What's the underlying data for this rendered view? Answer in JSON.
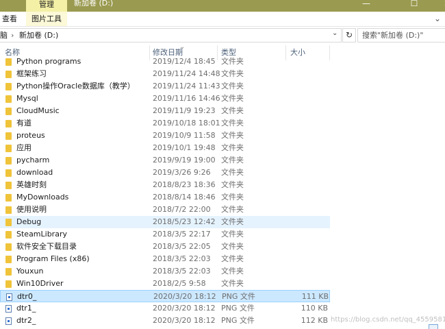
{
  "titlebar": {
    "manage_tab": "管理",
    "title": "新加卷 (D:)",
    "minimize_glyph": "—",
    "maximize_glyph": "☐",
    "close_glyph": "✕"
  },
  "ribbon": {
    "view_tab": "查看",
    "picture_tools_tab": "图片工具",
    "expand_glyph": "⌄"
  },
  "address": {
    "prefix": "脑",
    "separator": "›",
    "segment": "新加卷 (D:)",
    "dropdown_glyph": "⌄",
    "refresh_glyph": "↻",
    "search_placeholder": "搜索\"新加卷 (D:)\""
  },
  "columns": {
    "name": "名称",
    "date": "修改日期",
    "type": "类型",
    "size": "大小",
    "sort_glyph": "⌄"
  },
  "files": [
    {
      "name": "Python programs",
      "date": "2019/12/4 18:45",
      "type": "文件夹",
      "size": "",
      "icon": "folder-icon"
    },
    {
      "name": "框架练习",
      "date": "2019/11/24 14:48",
      "type": "文件夹",
      "size": "",
      "icon": "folder-icon"
    },
    {
      "name": "Python操作Oracle数据库（教学）",
      "date": "2019/11/24 11:43",
      "type": "文件夹",
      "size": "",
      "icon": "folder-icon"
    },
    {
      "name": "Mysql",
      "date": "2019/11/16 14:46",
      "type": "文件夹",
      "size": "",
      "icon": "folder-icon"
    },
    {
      "name": "CloudMusic",
      "date": "2019/11/9 19:23",
      "type": "文件夹",
      "size": "",
      "icon": "folder-icon"
    },
    {
      "name": "有道",
      "date": "2019/10/18 18:01",
      "type": "文件夹",
      "size": "",
      "icon": "folder-icon"
    },
    {
      "name": "proteus",
      "date": "2019/10/9 11:58",
      "type": "文件夹",
      "size": "",
      "icon": "folder-icon"
    },
    {
      "name": "应用",
      "date": "2019/10/1 19:48",
      "type": "文件夹",
      "size": "",
      "icon": "folder-icon"
    },
    {
      "name": "pycharm",
      "date": "2019/9/19 19:00",
      "type": "文件夹",
      "size": "",
      "icon": "folder-icon"
    },
    {
      "name": "download",
      "date": "2019/3/26 9:26",
      "type": "文件夹",
      "size": "",
      "icon": "folder-icon"
    },
    {
      "name": "英雄时刻",
      "date": "2018/8/23 18:36",
      "type": "文件夹",
      "size": "",
      "icon": "folder-icon"
    },
    {
      "name": "MyDownloads",
      "date": "2018/8/14 18:46",
      "type": "文件夹",
      "size": "",
      "icon": "folder-icon"
    },
    {
      "name": "使用说明",
      "date": "2018/7/2 22:00",
      "type": "文件夹",
      "size": "",
      "icon": "folder-icon"
    },
    {
      "name": "Debug",
      "date": "2018/5/23 12:42",
      "type": "文件夹",
      "size": "",
      "icon": "folder-icon",
      "state": "hover"
    },
    {
      "name": "SteamLibrary",
      "date": "2018/3/5 22:17",
      "type": "文件夹",
      "size": "",
      "icon": "folder-icon"
    },
    {
      "name": "软件安全下载目录",
      "date": "2018/3/5 22:05",
      "type": "文件夹",
      "size": "",
      "icon": "folder-icon"
    },
    {
      "name": "Program Files (x86)",
      "date": "2018/3/5 22:03",
      "type": "文件夹",
      "size": "",
      "icon": "folder-icon"
    },
    {
      "name": "Youxun",
      "date": "2018/3/5 22:03",
      "type": "文件夹",
      "size": "",
      "icon": "folder-icon"
    },
    {
      "name": "Win10Driver",
      "date": "2018/2/5 9:58",
      "type": "文件夹",
      "size": "",
      "icon": "folder-icon"
    },
    {
      "name": "dtr0_",
      "date": "2020/3/20 18:12",
      "type": "PNG 文件",
      "size": "111 KB",
      "icon": "png-file-icon",
      "state": "selected"
    },
    {
      "name": "dtr1_",
      "date": "2020/3/20 18:12",
      "type": "PNG 文件",
      "size": "110 KB",
      "icon": "png-file-icon"
    },
    {
      "name": "dtr2_",
      "date": "2020/3/20 18:12",
      "type": "PNG 文件",
      "size": "112 KB",
      "icon": "png-file-icon"
    }
  ],
  "watermark": "https://blog.csdn.net/qq_45595817",
  "colors": {
    "title_bar": "#9a9a50",
    "manage_tab": "#f4f0a6",
    "hover_row": "#e5f3ff",
    "selected_row": "#cce8ff",
    "folder": "#f0c43a"
  }
}
